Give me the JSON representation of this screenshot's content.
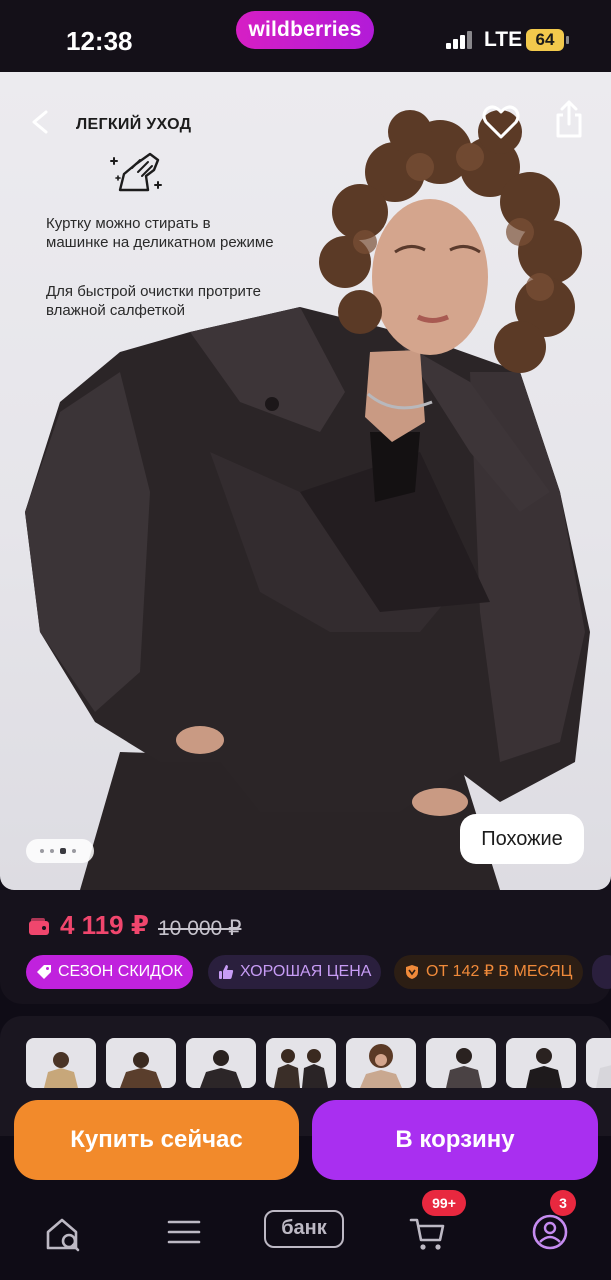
{
  "status_bar": {
    "time": "12:38",
    "brand": "wildberries",
    "network": "LTE",
    "battery": "64"
  },
  "care": {
    "title": "ЛЕГКИЙ УХОД",
    "text1": "Куртку можно стирать в машинке на деликатном режиме",
    "text2": "Для быстрой очистки протрите влажной салфеткой"
  },
  "gallery": {
    "similar_label": "Похожие",
    "current_index": 3,
    "total_indicators": 4
  },
  "price": {
    "current": "4 119 ₽",
    "old": "10 000 ₽",
    "current_color": "#f0466d"
  },
  "badges": {
    "sale": "СЕЗОН СКИДОК",
    "good_price": "ХОРОШАЯ ЦЕНА",
    "installment": "ОТ 142 ₽ В МЕСЯЦ"
  },
  "actions": {
    "buy_now": "Купить сейчас",
    "to_cart": "В корзину"
  },
  "nav": {
    "bank": "банк",
    "cart_badge": "99+",
    "profile_badge": "3"
  },
  "colors": {
    "brand": "#c022dd",
    "buy_now": "#f28a2b",
    "to_cart": "#a92ff0"
  }
}
